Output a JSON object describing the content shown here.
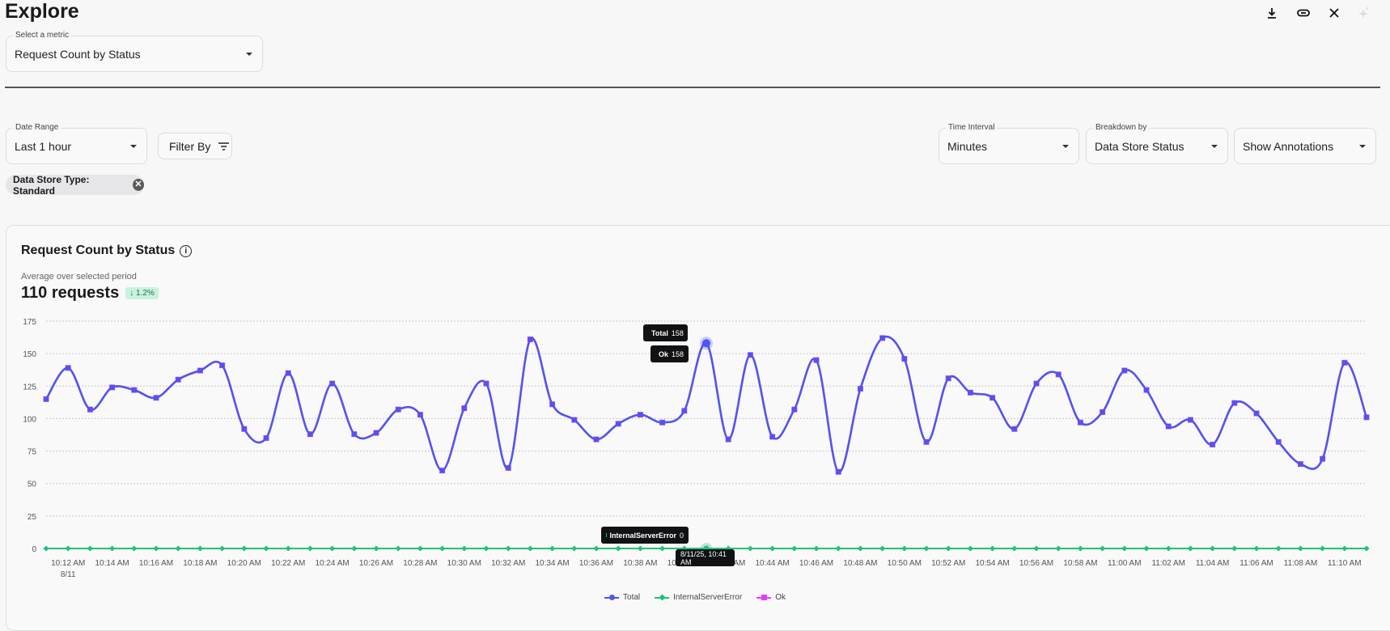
{
  "header": {
    "title": "Explore",
    "icons": [
      "download-icon",
      "link-icon",
      "close-icon",
      "sparkle-icon"
    ]
  },
  "metric_select": {
    "label": "Select a metric",
    "value": "Request Count by Status"
  },
  "filters": {
    "date_range": {
      "label": "Date Range",
      "value": "Last 1 hour"
    },
    "filter_by": {
      "label": "Filter By"
    },
    "time_interval": {
      "label": "Time Interval",
      "value": "Minutes"
    },
    "breakdown": {
      "label": "Breakdown by",
      "value": "Data Store Status"
    },
    "annotations": {
      "value": "Show Annotations"
    },
    "chips": [
      {
        "label": "Data Store Type: Standard"
      }
    ]
  },
  "card": {
    "title": "Request Count by Status",
    "subtitle": "Average over selected period",
    "summary": "110 requests",
    "change": "↓ 1.2%"
  },
  "tooltip": {
    "rows": [
      {
        "name": "Total",
        "value": "158"
      },
      {
        "name": "Ok",
        "value": "158"
      },
      {
        "name": "InternalServerError",
        "value": "0"
      }
    ],
    "date": "8/11/25, 10:41 AM"
  },
  "chart_data": {
    "type": "line",
    "x_start": "10:11 AM",
    "x_interval": "1 minute",
    "x_ticks": [
      "10:12 AM",
      "10:14 AM",
      "10:16 AM",
      "10:18 AM",
      "10:20 AM",
      "10:22 AM",
      "10:24 AM",
      "10:26 AM",
      "10:28 AM",
      "10:30 AM",
      "10:32 AM",
      "10:34 AM",
      "10:36 AM",
      "10:38 AM",
      "10:40 AM",
      "10:42 AM",
      "10:44 AM",
      "10:46 AM",
      "10:48 AM",
      "10:50 AM",
      "10:52 AM",
      "10:54 AM",
      "10:56 AM",
      "10:58 AM",
      "11:00 AM",
      "11:02 AM",
      "11:04 AM",
      "11:06 AM",
      "11:08 AM",
      "11:10 AM"
    ],
    "x_subtick": "8/11",
    "y_ticks": [
      0,
      25,
      50,
      75,
      100,
      125,
      150,
      175
    ],
    "ylim": [
      0,
      175
    ],
    "grid": true,
    "legend": "bottom",
    "hover_index": 30,
    "series": [
      {
        "name": "Total",
        "color": "#4f55f0",
        "values": [
          115,
          139,
          107,
          124,
          122,
          116,
          130,
          137,
          141,
          92,
          85,
          135,
          88,
          127,
          88,
          89,
          107,
          103,
          60,
          108,
          127,
          62,
          161,
          111,
          99,
          84,
          96,
          103,
          97,
          106,
          158,
          84,
          149,
          86,
          107,
          145,
          59,
          123,
          162,
          146,
          82,
          131,
          120,
          116,
          92,
          127,
          134,
          97,
          105,
          137,
          122,
          94,
          99,
          80,
          112,
          104,
          82,
          65,
          69,
          143,
          101
        ]
      },
      {
        "name": "InternalServerError",
        "color": "#22c07a",
        "values": [
          0,
          0,
          0,
          0,
          0,
          0,
          0,
          0,
          0,
          0,
          0,
          0,
          0,
          0,
          0,
          0,
          0,
          0,
          0,
          0,
          0,
          0,
          0,
          0,
          0,
          0,
          0,
          0,
          0,
          0,
          0,
          0,
          0,
          0,
          0,
          0,
          0,
          0,
          0,
          0,
          0,
          0,
          0,
          0,
          0,
          0,
          0,
          0,
          0,
          0,
          0,
          0,
          0,
          0,
          0,
          0,
          0,
          0,
          0,
          0,
          0
        ]
      },
      {
        "name": "Ok",
        "color": "#e040fb",
        "values": [
          115,
          139,
          107,
          124,
          122,
          116,
          130,
          137,
          141,
          92,
          85,
          135,
          88,
          127,
          88,
          89,
          107,
          103,
          60,
          108,
          127,
          62,
          161,
          111,
          99,
          84,
          96,
          103,
          97,
          106,
          158,
          84,
          149,
          86,
          107,
          145,
          59,
          123,
          162,
          146,
          82,
          131,
          120,
          116,
          92,
          127,
          134,
          97,
          105,
          137,
          122,
          94,
          99,
          80,
          112,
          104,
          82,
          65,
          69,
          143,
          101
        ]
      }
    ]
  }
}
